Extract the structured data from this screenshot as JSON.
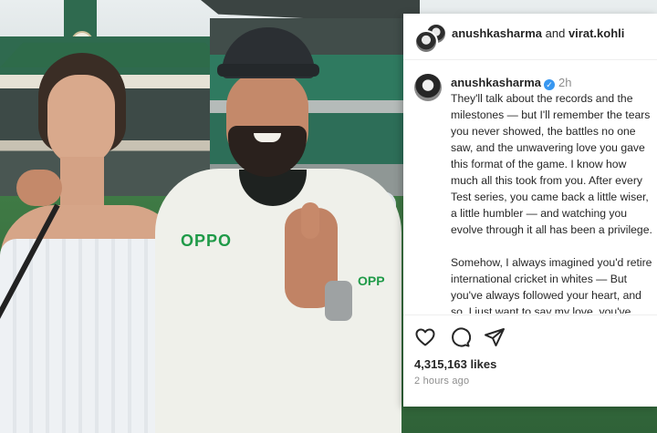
{
  "header": {
    "user1": "anushkasharma",
    "joiner": "and",
    "user2": "virat.kohli"
  },
  "post": {
    "username": "anushkasharma",
    "time": "2h",
    "caption": [
      "They'll talk about the records and the milestones — but I'll remember the tears you never showed, the battles no one saw, and the unwavering love you gave this format of the game. I know how much all this took from you. After every Test series, you came back a little wiser, a little humbler — and watching you evolve through it all has been a privilege.",
      "Somehow, I always imagined you'd retire international cricket in whites — But you've always followed your heart, and so, I just want to say my love, you've"
    ]
  },
  "actions": {
    "like_icon": "heart-icon",
    "comment_icon": "comment-icon",
    "share_icon": "share-icon"
  },
  "likes": "4,315,163 likes",
  "posted": "2 hours ago",
  "photo": {
    "jersey_brand": "OPPO",
    "jersey_brand_sleeve": "OPP"
  },
  "colors": {
    "verified": "#3897f0",
    "text": "#262626",
    "muted": "#8e8e8e",
    "jersey_logo": "#1f9a48"
  }
}
